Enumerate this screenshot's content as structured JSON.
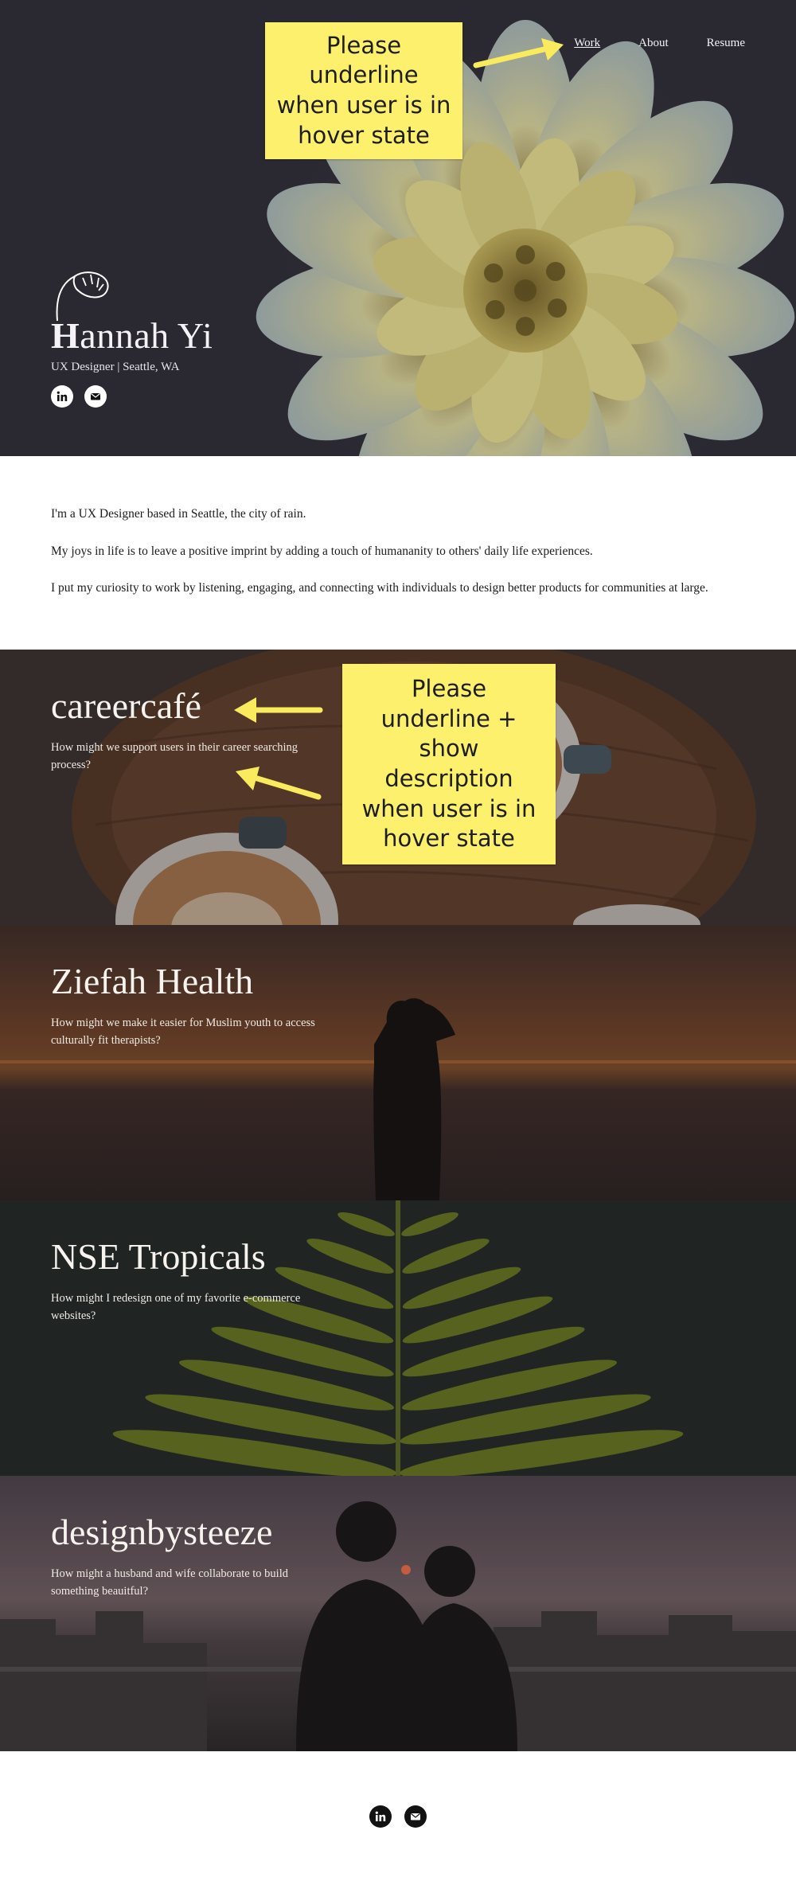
{
  "nav": {
    "items": [
      "Work",
      "About",
      "Resume"
    ]
  },
  "hero": {
    "name_initial": "H",
    "name_rest": "annah Yi",
    "subtitle": "UX Designer | Seattle, WA"
  },
  "socials": {
    "icons": [
      "linkedin-icon",
      "mail-icon"
    ]
  },
  "notes": {
    "nav_hover": "Please underline when user is in hover state",
    "project_hover": "Please underline + show description when user is in hover state"
  },
  "intro": {
    "p1": "I'm a UX Designer based in Seattle, the city of rain.",
    "p2": "My joys in life is to leave a positive imprint by adding a touch of humananity to others' daily life experiences.",
    "p3": "I put my curiosity to work by listening, engaging, and connecting with individuals to design better products for communities at large."
  },
  "projects": [
    {
      "title": "careercafé",
      "description": "How might we support users in their career searching process?"
    },
    {
      "title": "Ziefah Health",
      "description": "How might we make it easier for Muslim youth to access culturally fit therapists?"
    },
    {
      "title": "NSE Tropicals",
      "description": "How might I redesign one of my favorite e-commerce websites?"
    },
    {
      "title": "designbysteeze",
      "description": "How might a husband and wife collaborate to build something beauitful?"
    }
  ],
  "colors": {
    "note_yellow": "#fdf06d",
    "hero_bg": "#2b2832",
    "arrow_yellow": "#f9ea5e"
  }
}
